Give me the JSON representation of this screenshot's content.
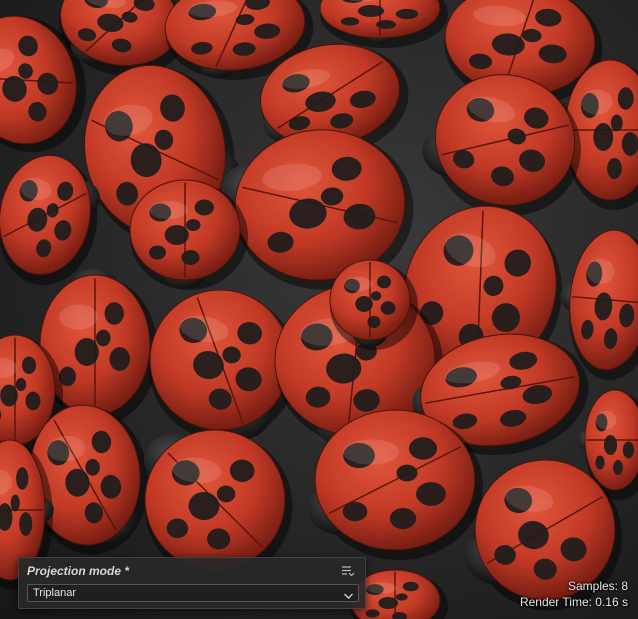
{
  "viewport": {
    "description_icon": "ladybug-render"
  },
  "projection_panel": {
    "title": "Projection mode *",
    "menu_icon": "list-options-icon",
    "select_value": "Triplanar",
    "chevron_icon": "chevron-down-icon"
  },
  "render_stats": {
    "samples": "Samples: 8",
    "render_time": "Render Time: 0.16 s"
  },
  "colors": {
    "shell": "#c23a26",
    "spot": "#1c1c1c",
    "panel_bg": "#282828"
  }
}
